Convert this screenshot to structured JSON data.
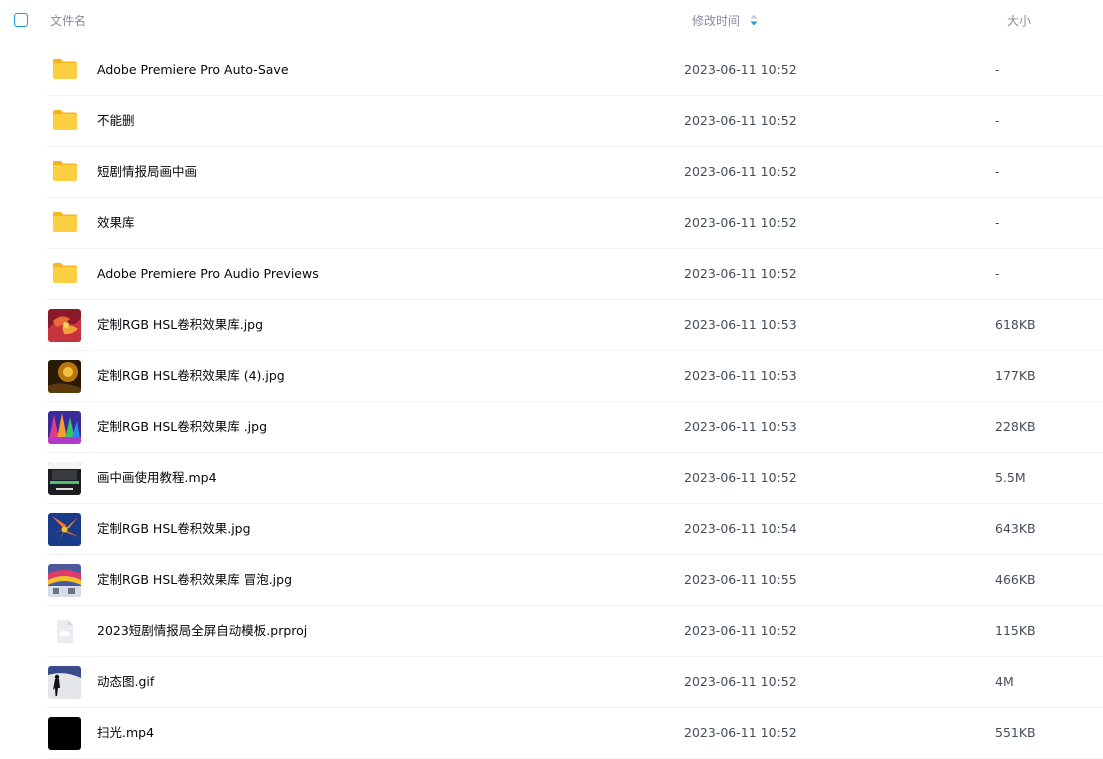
{
  "header": {
    "name_label": "文件名",
    "time_label": "修改时间",
    "size_label": "大小",
    "sort_icon": "sort-descending-icon"
  },
  "files": [
    {
      "name": "Adobe Premiere Pro Auto-Save",
      "time": "2023-06-11 10:52",
      "size": "-",
      "icon": "folder-icon"
    },
    {
      "name": "不能删",
      "time": "2023-06-11 10:52",
      "size": "-",
      "icon": "folder-icon"
    },
    {
      "name": "短剧情报局画中画",
      "time": "2023-06-11 10:52",
      "size": "-",
      "icon": "folder-icon"
    },
    {
      "name": "效果库",
      "time": "2023-06-11 10:52",
      "size": "-",
      "icon": "folder-icon"
    },
    {
      "name": "Adobe Premiere Pro Audio Previews",
      "time": "2023-06-11 10:52",
      "size": "-",
      "icon": "folder-icon"
    },
    {
      "name": "定制RGB HSL卷积效果库.jpg",
      "time": "2023-06-11 10:53",
      "size": "618KB",
      "icon": "image-thumbnail"
    },
    {
      "name": "定制RGB HSL卷积效果库 (4).jpg",
      "time": "2023-06-11 10:53",
      "size": "177KB",
      "icon": "image-thumbnail"
    },
    {
      "name": "定制RGB HSL卷积效果库 .jpg",
      "time": "2023-06-11 10:53",
      "size": "228KB",
      "icon": "image-thumbnail"
    },
    {
      "name": "画中画使用教程.mp4",
      "time": "2023-06-11 10:52",
      "size": "5.5M",
      "icon": "video-thumbnail"
    },
    {
      "name": "定制RGB HSL卷积效果.jpg",
      "time": "2023-06-11 10:54",
      "size": "643KB",
      "icon": "image-thumbnail"
    },
    {
      "name": "定制RGB HSL卷积效果库 冒泡.jpg",
      "time": "2023-06-11 10:55",
      "size": "466KB",
      "icon": "image-thumbnail"
    },
    {
      "name": "2023短剧情报局全屏自动模板.prproj",
      "time": "2023-06-11 10:52",
      "size": "115KB",
      "icon": "cloud-file-icon"
    },
    {
      "name": "动态图.gif",
      "time": "2023-06-11 10:52",
      "size": "4M",
      "icon": "gif-thumbnail"
    },
    {
      "name": "扫光.mp4",
      "time": "2023-06-11 10:52",
      "size": "551KB",
      "icon": "video-thumbnail"
    }
  ],
  "colors": {
    "accent": "#1e9bd7",
    "folder": "#fcc936"
  }
}
